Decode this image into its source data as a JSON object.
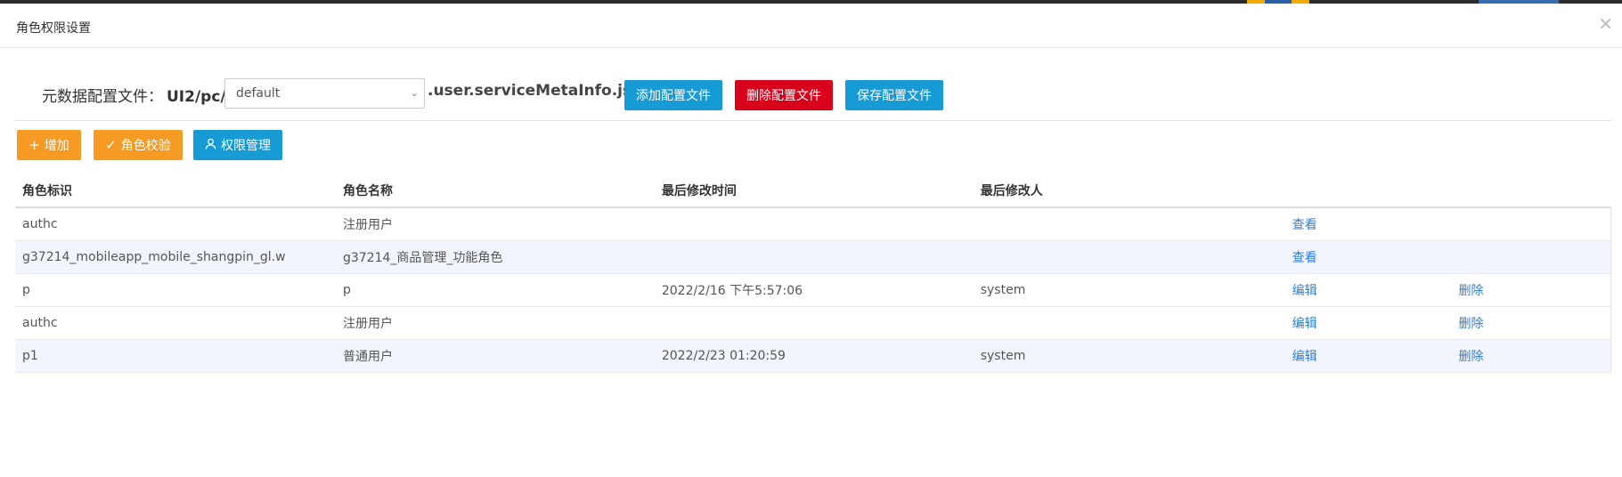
{
  "dialog": {
    "title": "角色权限设置",
    "close_symbol": "×"
  },
  "config": {
    "label": "元数据配置文件：",
    "path": "UI2/pc/",
    "selected": "default",
    "suffix": ".user.serviceMetaInfo.json",
    "add_label": "添加配置文件",
    "delete_label": "删除配置文件",
    "save_label": "保存配置文件"
  },
  "toolbar": {
    "add_label": "增加",
    "validate_label": "角色校验",
    "permission_label": "权限管理"
  },
  "table": {
    "columns": [
      "角色标识",
      "角色名称",
      "最后修改时间",
      "最后修改人"
    ],
    "rows": [
      {
        "id": "authc",
        "name": "注册用户",
        "modified_time": "",
        "modifier": "",
        "action1": "查看",
        "action2": ""
      },
      {
        "id": "g37214_mobileapp_mobile_shangpin_gl.w",
        "name": "g37214_商品管理_功能角色",
        "modified_time": "",
        "modifier": "",
        "action1": "查看",
        "action2": ""
      },
      {
        "id": "p",
        "name": "p",
        "modified_time": "2022/2/16 下午5:57:06",
        "modifier": "system",
        "action1": "编辑",
        "action2": "删除"
      },
      {
        "id": "authc",
        "name": "注册用户",
        "modified_time": "",
        "modifier": "",
        "action1": "编辑",
        "action2": "删除"
      },
      {
        "id": "p1",
        "name": "普通用户",
        "modified_time": "2022/2/23 01:20:59",
        "modifier": "system",
        "action1": "编辑",
        "action2": "删除"
      }
    ]
  },
  "colors": {
    "blue": "#169bd5",
    "red": "#d9001b",
    "orange": "#f59a23",
    "link": "#2f7fd6",
    "row_alt": "#f2f5fc"
  },
  "icons": {
    "add": "plus-icon",
    "validate": "check-icon",
    "permission": "user-icon",
    "close": "close-icon",
    "select": "chevron-down-icon"
  }
}
